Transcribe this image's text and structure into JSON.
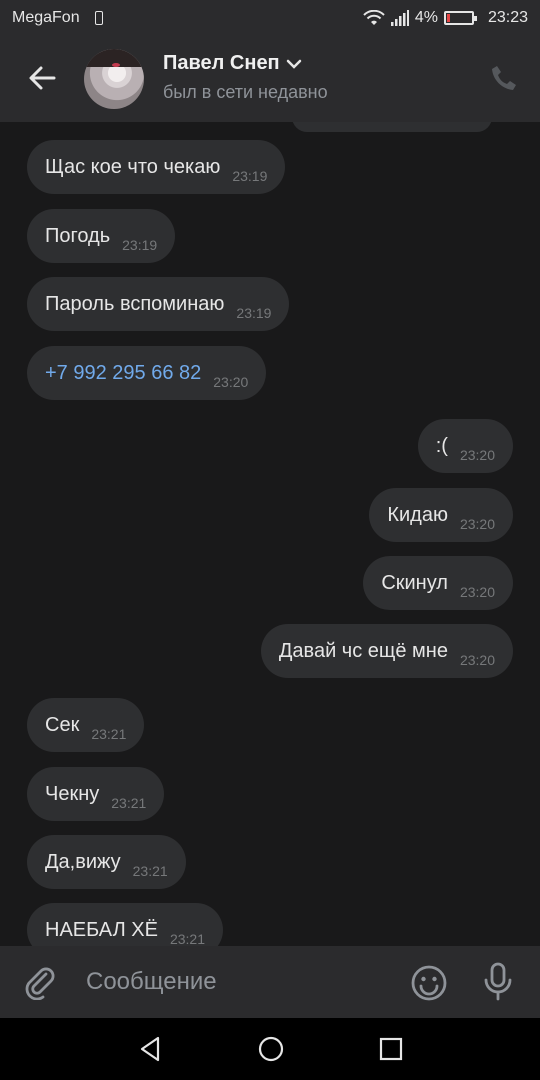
{
  "status_bar": {
    "carrier": "MegaFon",
    "battery_percent": "4%",
    "time": "23:23"
  },
  "header": {
    "contact_name": "Павел Снеп",
    "contact_status": "был в сети недавно",
    "icons": [
      "back-arrow-icon",
      "chevron-down-icon",
      "phone-icon"
    ]
  },
  "messages": [
    {
      "side": "left",
      "text": "Щас кое что чекаю",
      "time": "23:19"
    },
    {
      "side": "left",
      "text": "Погодь",
      "time": "23:19"
    },
    {
      "side": "left",
      "text": "Пароль вспоминаю",
      "time": "23:19"
    },
    {
      "side": "left",
      "text": "+7 992 295 66 82",
      "time": "23:20",
      "link": true
    },
    {
      "side": "right",
      "text": ":(",
      "time": "23:20"
    },
    {
      "side": "right",
      "text": "Кидаю",
      "time": "23:20"
    },
    {
      "side": "right",
      "text": "Скинул",
      "time": "23:20"
    },
    {
      "side": "right",
      "text": "Давай чс ещё мне",
      "time": "23:20"
    },
    {
      "side": "left",
      "text": "Сек",
      "time": "23:21"
    },
    {
      "side": "left",
      "text": "Чекну",
      "time": "23:21"
    },
    {
      "side": "left",
      "text": "Да,вижу",
      "time": "23:21"
    },
    {
      "side": "left",
      "text": "НАЕБАЛ ХЁ",
      "time": "23:21"
    }
  ],
  "composer": {
    "placeholder": "Сообщение"
  },
  "colors": {
    "background": "#19191a",
    "bar": "#2b2b2d",
    "bubble": "#2e2f31",
    "link": "#71aaeb"
  }
}
